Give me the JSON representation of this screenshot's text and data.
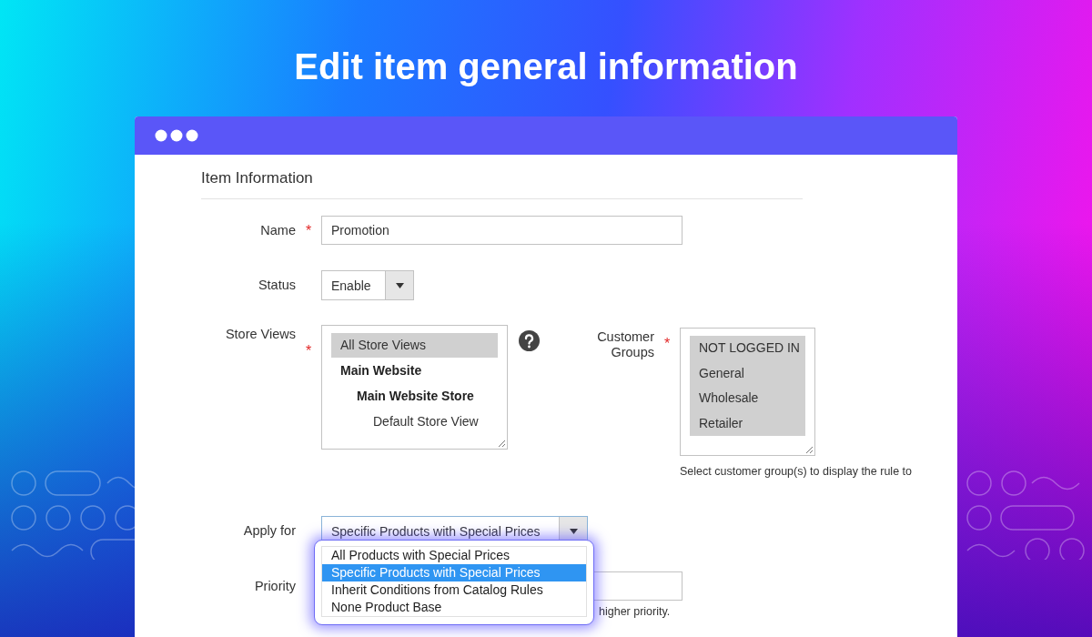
{
  "headline": "Edit item general information",
  "section_title": "Item Information",
  "required_mark": "*",
  "name": {
    "label": "Name",
    "required": true,
    "value": "Promotion"
  },
  "status": {
    "label": "Status",
    "required": false,
    "value": "Enable"
  },
  "store_views": {
    "label": "Store Views",
    "required": true,
    "options": [
      {
        "label": "All Store Views",
        "kind": "option",
        "selected": true
      },
      {
        "label": "Main Website",
        "kind": "group",
        "selected": false,
        "children": [
          {
            "label": "Main Website Store",
            "kind": "group",
            "selected": false,
            "children": [
              {
                "label": "Default Store View",
                "kind": "option",
                "selected": false
              }
            ]
          }
        ]
      }
    ]
  },
  "customer_groups": {
    "label": "Customer Groups",
    "required": true,
    "hint": "Select customer group(s) to display the rule to",
    "options": [
      {
        "label": "NOT LOGGED IN",
        "selected": true
      },
      {
        "label": "General",
        "selected": true
      },
      {
        "label": "Wholesale",
        "selected": true
      },
      {
        "label": "Retailer",
        "selected": true
      }
    ]
  },
  "apply_for": {
    "label": "Apply for",
    "required": false,
    "value": "Specific Products with Special Prices",
    "expanded": true,
    "options": [
      {
        "label": "All Products with Special Prices",
        "selected": false
      },
      {
        "label": "Specific Products with Special Prices",
        "selected": true
      },
      {
        "label": "Inherit Conditions from Catalog Rules",
        "selected": false
      },
      {
        "label": "None Product Base",
        "selected": false
      }
    ]
  },
  "priority": {
    "label": "Priority",
    "required": false,
    "hint": "higher priority."
  }
}
